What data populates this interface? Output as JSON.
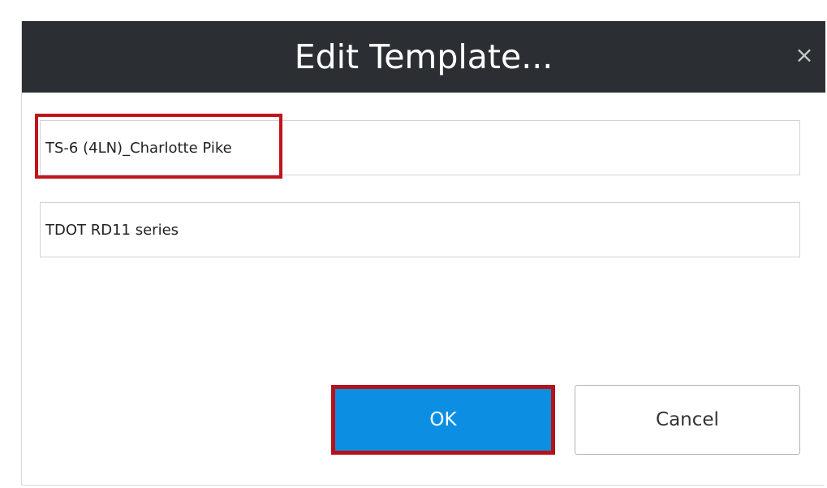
{
  "dialog": {
    "title": "Edit Template...",
    "close_glyph": "×",
    "close_icon": "close-icon"
  },
  "fields": {
    "name_value": "TS-6 (4LN)_Charlotte Pike",
    "description_value": "TDOT RD11 series"
  },
  "buttons": {
    "ok_label": "OK",
    "cancel_label": "Cancel"
  },
  "colors": {
    "title_bar": "#2b2f33",
    "primary_button": "#0c8fe3",
    "highlight": "#c0141c"
  }
}
